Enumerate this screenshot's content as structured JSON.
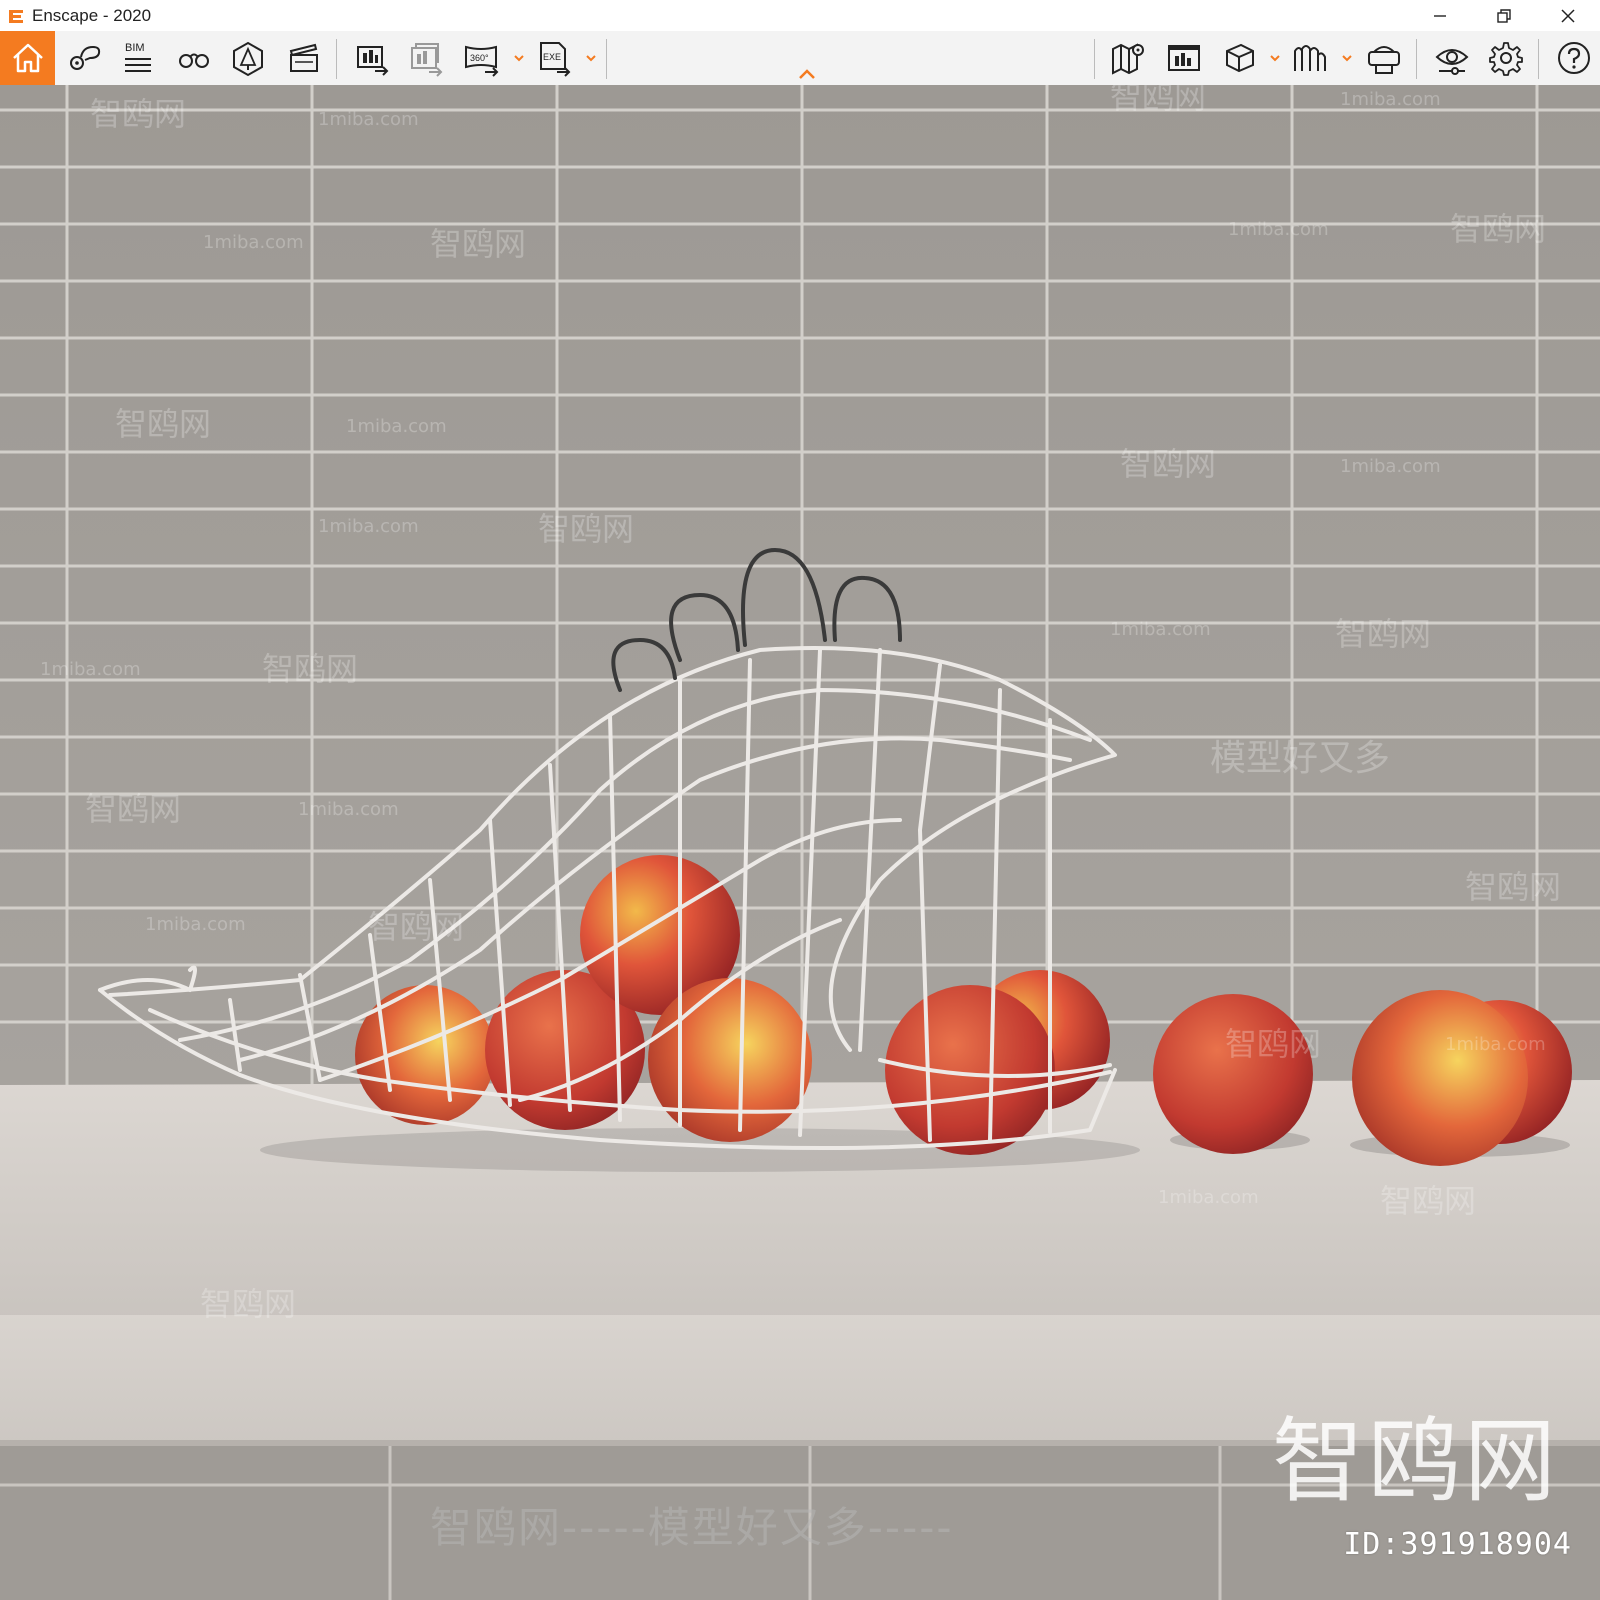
{
  "window": {
    "title": "Enscape - 2020"
  },
  "toolbar": {
    "left_buttons": [
      "home-icon",
      "pin-chat-icon",
      "bim-icon",
      "binoculars-icon",
      "tree-icon",
      "clapper-icon",
      "screenshot-export-icon",
      "batch-render-icon",
      "panorama-360-icon",
      "exe-export-icon"
    ],
    "bim_label": "BIM",
    "panorama_label": "360°",
    "exe_label": "EXE",
    "right_buttons": [
      "map-icon",
      "screen-icon",
      "cube-icon",
      "vr-landscape-icon",
      "vr-headset-icon",
      "eye-icon",
      "gear-icon",
      "help-icon"
    ],
    "accent_color": "#f47b20"
  },
  "watermark": {
    "id_text": "ID:391918904",
    "brand_big": "智鸥网",
    "bottom_line": "智鸥网-----模型好又多-----",
    "small_site": "1miba.com",
    "small_brand": "智鸥网",
    "slogan": "模型好又多"
  }
}
